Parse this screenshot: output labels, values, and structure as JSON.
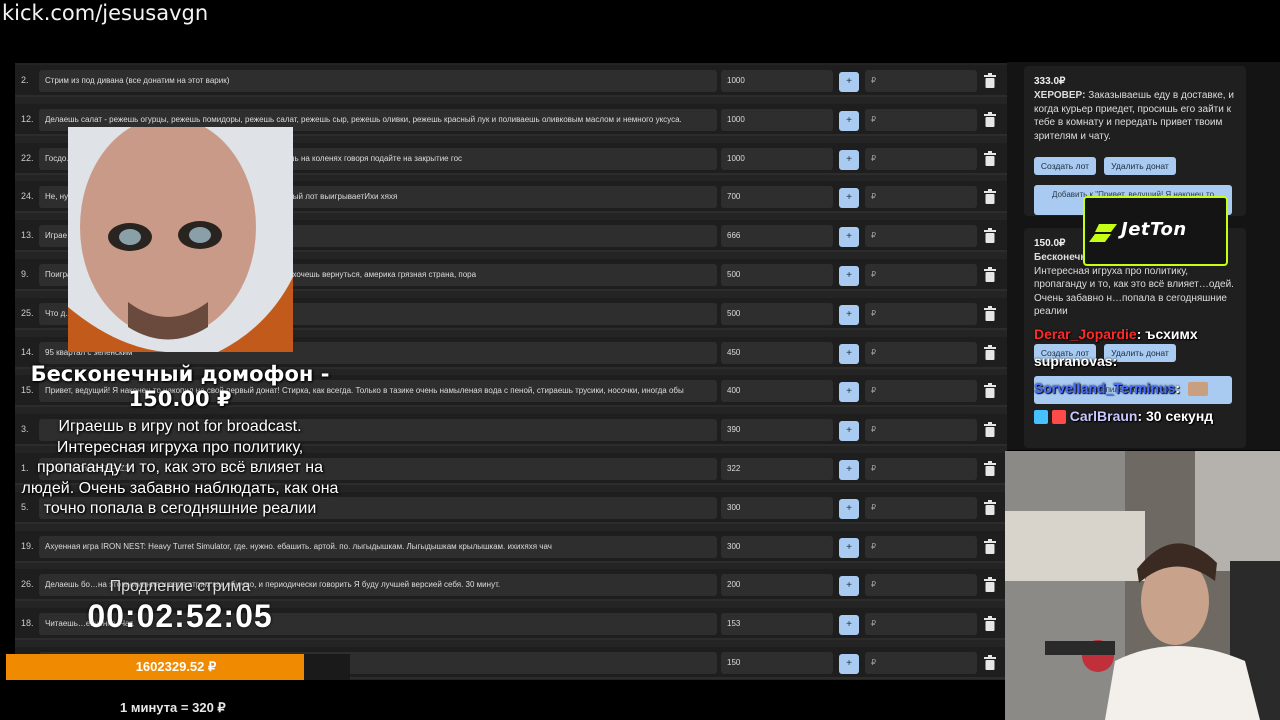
{
  "channel_url": "kick.com/jesusavgn",
  "lots": [
    {
      "num": "2.",
      "title": "Стрим из под дивана (все донатим на этот варик)",
      "amount": "1000"
    },
    {
      "num": "12.",
      "title": "Делаешь салат - режешь огурцы, режешь помидоры, режешь салат, режешь сыр, режешь оливки, режешь красный лук и поливаешь оливковым маслом и немного уксуса.",
      "amount": "1000"
    },
    {
      "num": "22.",
      "title": "Госдо…, следует из официальных данных. Так что 30 минут стоишь на коленях говоря подайте на закрытие гос",
      "amount": "1000"
    },
    {
      "num": "24.",
      "title": "Не, ну…, теперь пиво не за что братьЗакинь что третий репольнутый лот выигрываетИхи хяхя",
      "amount": "700"
    },
    {
      "num": "13.",
      "title": "Играе…",
      "amount": "666"
    },
    {
      "num": "9.",
      "title": "Поигра…нецк. Билеты можно не покупать, но говоришь что очень хочешь вернуться, америка грязная страна, пора",
      "amount": "500"
    },
    {
      "num": "25.",
      "title": "Что д… https://youtu.be/6gUC9Cbjz7o?si=AqcMOqinlhax2uud",
      "amount": "500"
    },
    {
      "num": "14.",
      "title": "95 квартал с зеленским",
      "amount": "450"
    },
    {
      "num": "15.",
      "title": "Привет, ведущий! Я наконец то накопил на свой первый донат! Стирка, как всегда. Только в тазике очень намыленая вода с пеной, стираешь трусики, носочки, иногда обы",
      "amount": "400"
    },
    {
      "num": "3.",
      "title": "",
      "amount": "390"
    },
    {
      "num": "1.",
      "title": "…ma73NJmYZKNFxZ1h",
      "amount": "322"
    },
    {
      "num": "5.",
      "title": "",
      "amount": "300"
    },
    {
      "num": "19.",
      "title": "Ахуенная игра IRON NEST: Heavy Turret Simulator, где. нужно. ебашить. артой. по. лыгыдышкам. Лыгыдышкам крылышкам. ихихяхя чач",
      "amount": "300"
    },
    {
      "num": "26.",
      "title": "Делаешь бо…на это внимания и ведя стрим как обычно, и периодически говорить Я буду лучшей версией себя. 30 минут.",
      "amount": "200"
    },
    {
      "num": "18.",
      "title": "Читаешь…евченко. Чат.",
      "amount": "153"
    },
    {
      "num": "",
      "title": "…нты с доставки если нету",
      "amount": "150"
    }
  ],
  "lot_add_label": "+",
  "lot_currency_placeholder": "₽",
  "donations": {
    "card1": {
      "amount": "333.0₽",
      "sender": "ХЕРОВЕР:",
      "message": "Заказываешь еду в доставке, и когда курьер приедет, просишь его зайти к тебе в комнату и передать привет твоим зрителям и чату.",
      "create_label": "Создать лот",
      "delete_label": "Удалить донат",
      "add_to_label": "Добавить к \"Привет, ведущий! Я наконец то"
    },
    "card2": {
      "amount": "150.0₽",
      "sender": "Бесконечный",
      "message": "not for broadcast. Интересная игруха про политику, пропаганду и то, как это всё влияет…одей. Очень забавно н…попала в сегодняшние реалии",
      "create_label": "Создать лот",
      "delete_label": "Удалить донат",
      "add_to_label": "накопила на свой пер…"
    }
  },
  "sponsor": {
    "name": "JetTon"
  },
  "chat": [
    {
      "user": "Derar_Jopardie",
      "message": ": ъсхимх",
      "color": "#ff2a2a"
    },
    {
      "user": "supranovas",
      "message": ":",
      "color": "#ffffff"
    },
    {
      "user": "Sorvelland_Terminus",
      "message": ":",
      "color": "#4a6fff"
    },
    {
      "user": "CarlBraun",
      "message": ": 30 секунд",
      "color": "#c9c9ff"
    }
  ],
  "alert": {
    "title": "Бесконечный домофон - 150.00 ₽",
    "message": "Играешь в игру not for broadcast. Интересная игруха про политику, пропаганду и то, как это всё влияет на людей. Очень забавно наблюдать, как она точно попала в сегодняшние реалии"
  },
  "timer": {
    "label": "Продление стрима",
    "value": "00:02:52:05"
  },
  "total": {
    "label": "1602329.52 ₽"
  },
  "rate": "1 минута = 320 ₽",
  "colors": {
    "accent_button": "#a9cbf1",
    "progress": "#f08a00",
    "background": "#242424",
    "sponsor": "#c4ff14"
  }
}
